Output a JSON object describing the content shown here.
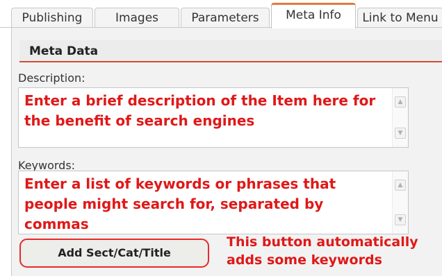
{
  "tabs": [
    {
      "label": "Publishing",
      "active": false
    },
    {
      "label": "Images",
      "active": false
    },
    {
      "label": "Parameters",
      "active": false
    },
    {
      "label": "Meta Info",
      "active": true
    },
    {
      "label": "Link to Menu",
      "active": false
    }
  ],
  "section": {
    "title": "Meta Data"
  },
  "description": {
    "label": "Description:",
    "value": "Enter a brief description of the Item here for the benefit of search engines"
  },
  "keywords": {
    "label": "Keywords:",
    "value": "Enter a list of keywords or phrases that people might search for, separated by commas"
  },
  "add_button": {
    "label": "Add Sect/Cat/Title"
  },
  "annotation": {
    "line1": "This button automatically",
    "line2": "adds some keywords"
  },
  "colors": {
    "annotation_red": "#e01818",
    "active_tab_accent": "#e07a3c",
    "header_rule": "#d24c35"
  },
  "icons": {
    "scroll_up": "scroll-up-arrow-icon",
    "scroll_down": "scroll-down-arrow-icon"
  }
}
